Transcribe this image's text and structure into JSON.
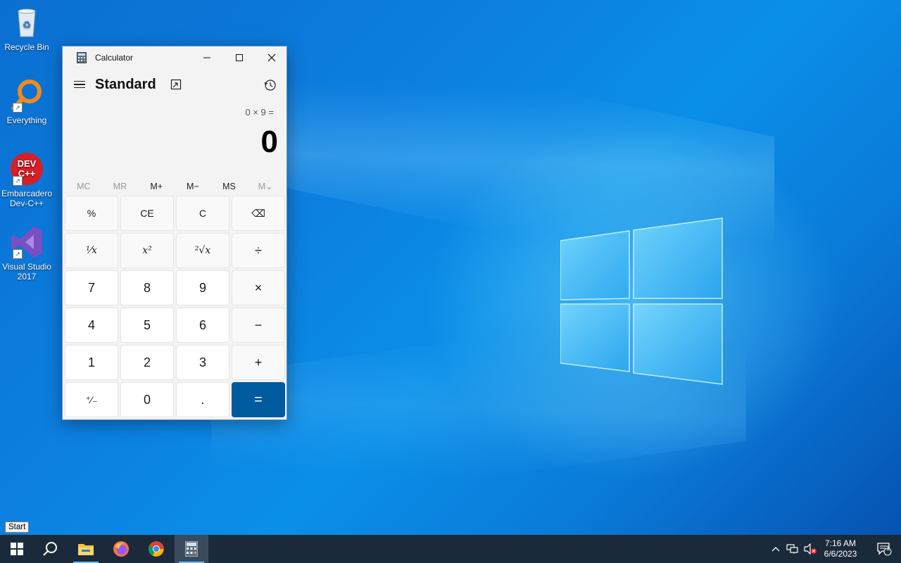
{
  "desktop": {
    "icons": [
      {
        "label": "Recycle Bin"
      },
      {
        "label": "Everything"
      },
      {
        "label": "Embarcadero Dev-C++"
      },
      {
        "label": "Visual Studio 2017"
      }
    ]
  },
  "calculator": {
    "window_title": "Calculator",
    "mode_label": "Standard",
    "expression": "0 × 9 =",
    "result": "0",
    "memory_buttons": [
      "MC",
      "MR",
      "M+",
      "M−",
      "MS",
      "M⌄"
    ],
    "keys": [
      [
        "%",
        "CE",
        "C",
        "⌫"
      ],
      [
        "¹⁄x",
        "x²",
        "²√x",
        "÷"
      ],
      [
        "7",
        "8",
        "9",
        "×"
      ],
      [
        "4",
        "5",
        "6",
        "−"
      ],
      [
        "1",
        "2",
        "3",
        "+"
      ],
      [
        "⁺⁄₋",
        "0",
        ".",
        "="
      ]
    ]
  },
  "taskbar": {
    "start_tooltip": "Start",
    "clock_time": "7:16 AM",
    "clock_date": "6/6/2023",
    "notification_count": "1"
  },
  "colors": {
    "accent": "#005a9e",
    "taskbar": "#1b2a3a",
    "desktop": "#0a7ad8"
  }
}
